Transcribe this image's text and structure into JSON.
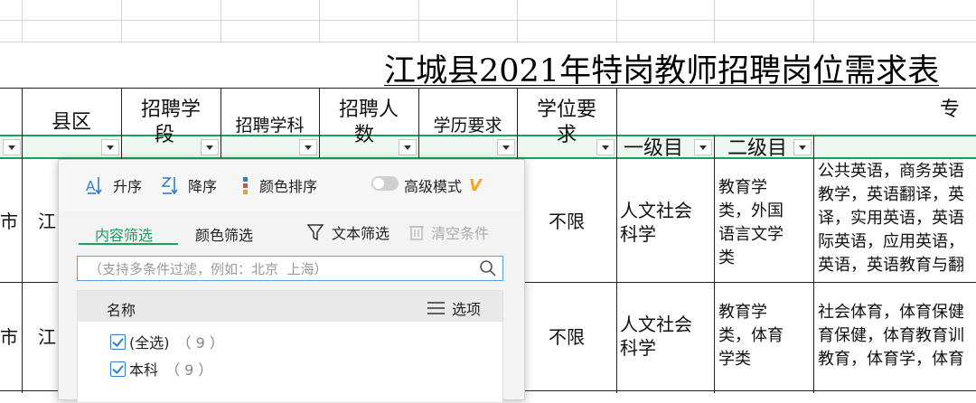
{
  "sheet": {
    "title": "江城县2021年特岗教师招聘岗位需求表",
    "headers": {
      "county": "县区",
      "stage_l1": "招聘学",
      "stage_l2": "段",
      "subject": "招聘学科",
      "count_l1": "招聘人",
      "count_l2": "数",
      "education": "学历要求",
      "degree_l1": "学位要",
      "degree_l2": "求",
      "major": "专"
    },
    "subheaders": {
      "level1": "一级目",
      "level2": "二级目"
    },
    "rows": [
      {
        "col0": "市",
        "col1": "江",
        "degree": "不限",
        "level1_l1": "人文社会",
        "level1_l2": "科学",
        "level2_lines": [
          "教育学",
          "类，外国",
          "语言文学",
          "类"
        ],
        "major_lines": [
          "公共英语，商务英语",
          "教学，英语翻译，英",
          "译，实用英语，英语",
          "际英语，应用英语，",
          "英语，英语教育与翻"
        ]
      },
      {
        "col0": "市",
        "col1": "江",
        "degree": "不限",
        "level1_l1": "人文社会",
        "level1_l2": "科学",
        "level2_lines": [
          "教育学",
          "类，体育",
          "学类"
        ],
        "major_lines": [
          "社会体育，体育保健",
          "育保健，体育教育训",
          "教育，体育学，体育"
        ]
      }
    ]
  },
  "filter_popup": {
    "sort_asc": "升序",
    "sort_desc": "降序",
    "sort_color": "颜色排序",
    "advanced_mode": "高级模式",
    "advanced_badge": "V",
    "tab_content": "内容筛选",
    "tab_color": "颜色筛选",
    "text_filter": "文本筛选",
    "clear_conditions": "清空条件",
    "search_placeholder": "（支持多条件过滤，例如：北京  上海）",
    "list_header_name": "名称",
    "list_options": "选项",
    "items": [
      {
        "label": "(全选)",
        "count": "（ 9 ）",
        "checked": true
      },
      {
        "label": "本科",
        "count": "（ 9 ）",
        "checked": true
      }
    ]
  },
  "colors": {
    "accent_green": "#1e9e5a",
    "checkbox_blue": "#2f7fd1",
    "vip_orange": "#f5a623"
  }
}
